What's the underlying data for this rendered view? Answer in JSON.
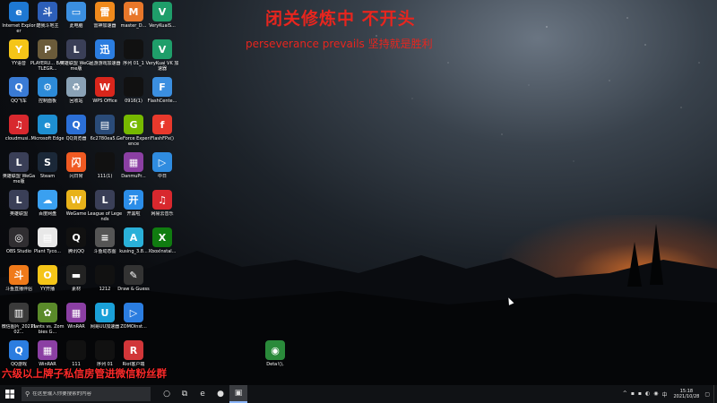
{
  "overlay": {
    "title": "闭关修炼中 不开头",
    "subtitle": "perseverance prevails  坚持就是胜利",
    "bottom_banner": "六级以上牌子私信房管进微信粉丝群"
  },
  "desktop_icons": [
    {
      "label": "Internet Explorer",
      "icon": "internet-explorer-icon",
      "color": "#1e78d2",
      "glyph": "e"
    },
    {
      "label": "酷我斗地主",
      "icon": "game-robot-icon",
      "color": "#2d5fb8",
      "glyph": "斗"
    },
    {
      "label": "此电脑",
      "icon": "this-pc-icon",
      "color": "#3b8fe0",
      "glyph": "▭"
    },
    {
      "label": "雷神加速器",
      "icon": "accelerator-icon",
      "color": "#f08a1c",
      "glyph": "雷"
    },
    {
      "label": "master_D...",
      "icon": "master-icon",
      "color": "#e8772a",
      "glyph": "M"
    },
    {
      "label": "VeryKuaiS...",
      "icon": "verykuai-icon",
      "color": "#1f9e6a",
      "glyph": "V"
    },
    {
      "label": "YY语音",
      "icon": "yy-icon",
      "color": "#f5c518",
      "glyph": "Y"
    },
    {
      "label": "PLAYERU... BATTLEGR...",
      "icon": "pubg-icon",
      "color": "#6b5b3a",
      "glyph": "P"
    },
    {
      "label": "英雄联盟 WeGame版",
      "icon": "lol-icon",
      "color": "#3a3f57",
      "glyph": "L"
    },
    {
      "label": "迅游游戏加速器",
      "icon": "xunyou-icon",
      "color": "#2b7de0",
      "glyph": "迅"
    },
    {
      "label": "序列 01_1",
      "icon": "video-file-icon",
      "color": "#111111",
      "glyph": ""
    },
    {
      "label": "VeryKuai VK 加速器",
      "icon": "verykuai-vk-icon",
      "color": "#1f9e6a",
      "glyph": "V"
    },
    {
      "label": "QQ飞车",
      "icon": "qq-speed-icon",
      "color": "#3a7bd5",
      "glyph": "Q"
    },
    {
      "label": "控制面板",
      "icon": "control-panel-icon",
      "color": "#2d8bd8",
      "glyph": "⚙"
    },
    {
      "label": "回收站",
      "icon": "recycle-bin-icon",
      "color": "#8aa2b6",
      "glyph": "♻"
    },
    {
      "label": "WPS Office",
      "icon": "wps-icon",
      "color": "#d9261c",
      "glyph": "W"
    },
    {
      "label": "0916(1)",
      "icon": "video-file-icon",
      "color": "#111111",
      "glyph": ""
    },
    {
      "label": "FlashCente...",
      "icon": "flash-center-icon",
      "color": "#3b8fe0",
      "glyph": "F"
    },
    {
      "label": "cloudmusi...",
      "icon": "netease-music-icon",
      "color": "#d8282e",
      "glyph": "♫"
    },
    {
      "label": "Microsoft Edge",
      "icon": "edge-icon",
      "color": "#1e8fd2",
      "glyph": "e"
    },
    {
      "label": "QQ浏览器",
      "icon": "qq-browser-icon",
      "color": "#2b6fd6",
      "glyph": "Q"
    },
    {
      "label": "6c2780ea5...",
      "icon": "file-icon",
      "color": "#2a4b78",
      "glyph": "▤"
    },
    {
      "label": "GeForce Experience",
      "icon": "geforce-icon",
      "color": "#76b900",
      "glyph": "G"
    },
    {
      "label": "FlashFPx()",
      "icon": "flash-player-icon",
      "color": "#e8392c",
      "glyph": "f"
    },
    {
      "label": "英雄联盟 WeGame版",
      "icon": "lol-icon",
      "color": "#3a3f57",
      "glyph": "L"
    },
    {
      "label": "Steam",
      "icon": "steam-icon",
      "color": "#1b2838",
      "glyph": "S"
    },
    {
      "label": "闪日常",
      "icon": "shanrichang-icon",
      "color": "#f05a22",
      "glyph": "闪"
    },
    {
      "label": "111(1)",
      "icon": "video-file-icon",
      "color": "#111111",
      "glyph": ""
    },
    {
      "label": "DanmuPr...",
      "icon": "winrar-icon",
      "color": "#8b3fa3",
      "glyph": "▦"
    },
    {
      "label": "中日",
      "icon": "zhongri-icon",
      "color": "#2f8ce0",
      "glyph": "▷"
    },
    {
      "label": "英雄联盟",
      "icon": "lol-icon",
      "color": "#3a3f57",
      "glyph": "L"
    },
    {
      "label": "百度网盘",
      "icon": "baidu-netdisk-icon",
      "color": "#3aa0f0",
      "glyph": "☁"
    },
    {
      "label": "WeGame",
      "icon": "wegame-icon",
      "color": "#e8b21a",
      "glyph": "W"
    },
    {
      "label": "League of Legends",
      "icon": "lol-icon",
      "color": "#3a3f57",
      "glyph": "L"
    },
    {
      "label": "开黑啦",
      "icon": "kaiheila-icon",
      "color": "#2b8de8",
      "glyph": "开"
    },
    {
      "label": "网易云音乐",
      "icon": "netease-music-icon",
      "color": "#d8282e",
      "glyph": "♫"
    },
    {
      "label": "OBS Studio",
      "icon": "obs-icon",
      "color": "#302e31",
      "glyph": "◎"
    },
    {
      "label": "Plant Tyco...",
      "icon": "document-icon",
      "color": "#e8e8e8",
      "glyph": "▤"
    },
    {
      "label": "腾讯QQ",
      "icon": "qq-icon",
      "color": "#111111",
      "glyph": "Q"
    },
    {
      "label": "斗鱼动态图",
      "icon": "douyu-icon",
      "color": "#555555",
      "glyph": "≡"
    },
    {
      "label": "kusing_3.8...",
      "icon": "kusing-icon",
      "color": "#2ab0d8",
      "glyph": "A"
    },
    {
      "label": "XboxInstal...",
      "icon": "xbox-icon",
      "color": "#107c10",
      "glyph": "X"
    },
    {
      "label": "斗鱼直播伴侣",
      "icon": "douyu-live-icon",
      "color": "#f07a1a",
      "glyph": "斗"
    },
    {
      "label": "YY开播",
      "icon": "yy-live-icon",
      "color": "#f5c518",
      "glyph": "O"
    },
    {
      "label": "素材",
      "icon": "folder-icon",
      "color": "#222222",
      "glyph": "▬"
    },
    {
      "label": "1212",
      "icon": "video-file-icon",
      "color": "#111111",
      "glyph": ""
    },
    {
      "label": "Draw & Guess",
      "icon": "draw-guess-icon",
      "color": "#333333",
      "glyph": "✎"
    },
    {
      "label": "微信图片_2021102...",
      "icon": "image-file-icon",
      "color": "#3a3a3a",
      "glyph": "▥"
    },
    {
      "label": "Plants vs. Zombies G...",
      "icon": "pvz-icon",
      "color": "#5a8a2a",
      "glyph": "✿"
    },
    {
      "label": "WinRAR",
      "icon": "winrar-icon",
      "color": "#8b3fa3",
      "glyph": "▦"
    },
    {
      "label": "网易UU加速器",
      "icon": "uu-booster-icon",
      "color": "#1aa0d8",
      "glyph": "U"
    },
    {
      "label": "ZOMOInst...",
      "icon": "zomo-icon",
      "color": "#2b7de0",
      "glyph": "▷"
    },
    {
      "label": "QQ游戏",
      "icon": "qq-game-icon",
      "color": "#2b7de0",
      "glyph": "Q"
    },
    {
      "label": "WinRAR",
      "icon": "winrar-icon",
      "color": "#8b3fa3",
      "glyph": "▦"
    },
    {
      "label": "111",
      "icon": "video-file-icon",
      "color": "#111111",
      "glyph": ""
    },
    {
      "label": "序列 01",
      "icon": "video-file-icon",
      "color": "#111111",
      "glyph": ""
    },
    {
      "label": "Riot客户端",
      "icon": "riot-client-icon",
      "color": "#d13639",
      "glyph": "R"
    },
    {
      "label": "Deta!(), ",
      "icon": "globe-icon",
      "color": "#2a8a3a",
      "glyph": "◉"
    }
  ],
  "taskbar": {
    "search_placeholder": "在这里输入你要搜索的内容",
    "apps": [
      {
        "icon": "task-view-icon",
        "glyph": "○"
      },
      {
        "icon": "multitask-icon",
        "glyph": "⧉"
      },
      {
        "icon": "edge-taskbar-icon",
        "glyph": "e"
      },
      {
        "icon": "wechat-icon",
        "glyph": "●"
      },
      {
        "icon": "active-app-icon",
        "glyph": "▣"
      }
    ],
    "tray_icons": [
      "chevron-up-icon",
      "tray-app-icon",
      "tray-app-icon-2",
      "network-icon",
      "volume-icon",
      "language-icon"
    ],
    "tray_glyphs": [
      "^",
      "▪",
      "▪",
      "◐",
      "◉",
      "中"
    ],
    "time": "15:18",
    "date": "2021/10/28"
  }
}
